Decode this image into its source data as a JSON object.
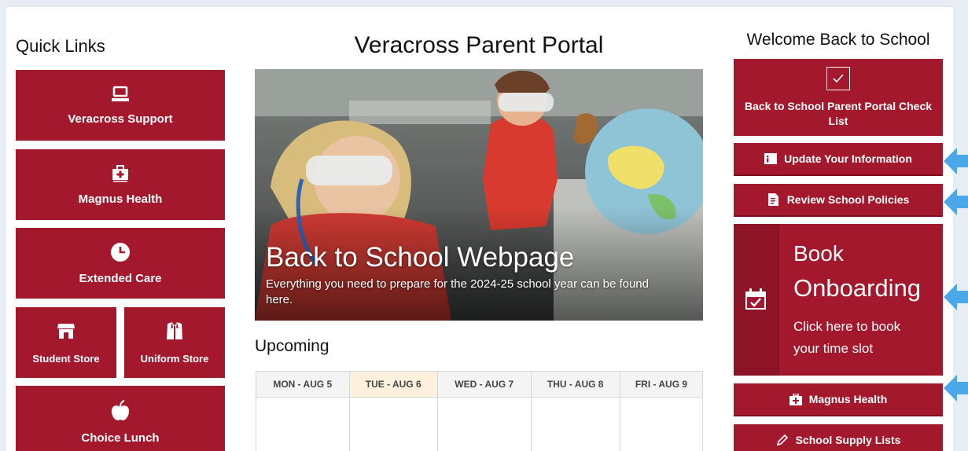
{
  "quick_links": {
    "title": "Quick Links",
    "items": [
      {
        "label": "Veracross Support",
        "icon": "laptop-icon"
      },
      {
        "label": "Magnus Health",
        "icon": "medical-kit-icon"
      },
      {
        "label": "Extended Care",
        "icon": "clock-icon"
      },
      {
        "label": "Student Store",
        "icon": "store-icon"
      },
      {
        "label": "Uniform Store",
        "icon": "shirt-icon"
      },
      {
        "label": "Choice Lunch",
        "icon": "apple-icon"
      }
    ]
  },
  "main": {
    "title": "Veracross Parent Portal",
    "hero": {
      "title": "Back to School Webpage",
      "subtitle": "Everything you need to prepare for the 2024-25 school year can be found here."
    },
    "upcoming": {
      "title": "Upcoming",
      "days": [
        "MON - AUG 5",
        "TUE - AUG 6",
        "WED - AUG 7",
        "THU - AUG 8",
        "FRI - AUG 9"
      ],
      "today_index": 1
    }
  },
  "welcome": {
    "title": "Welcome Back to School",
    "checklist": {
      "label": "Back to School Parent Portal Check List",
      "icon": "checkbox-icon"
    },
    "update_info": {
      "label": "Update Your Information",
      "icon": "info-card-icon"
    },
    "review_policies": {
      "label": "Review School Policies",
      "icon": "document-icon"
    },
    "book": {
      "title_line1": "Book",
      "title_line2": "Onboarding",
      "sub_line1": "Click here to book",
      "sub_line2": "your time slot",
      "icon": "calendar-check-icon"
    },
    "magnus": {
      "label": "Magnus Health",
      "icon": "medical-kit-icon"
    },
    "supplies": {
      "label": "School Supply Lists",
      "icon": "pencil-icon"
    }
  },
  "colors": {
    "brand_red": "#a3182d",
    "arrow_blue": "#4aa8e8",
    "today_highlight": "#fdf0dc"
  }
}
